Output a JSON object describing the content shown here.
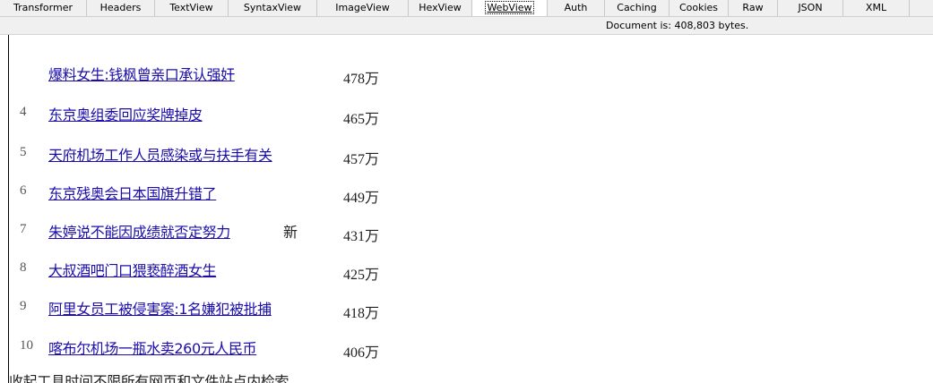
{
  "tabs": [
    {
      "label": "Transformer"
    },
    {
      "label": "Headers"
    },
    {
      "label": "TextView"
    },
    {
      "label": "SyntaxView"
    },
    {
      "label": "ImageView"
    },
    {
      "label": "HexView"
    },
    {
      "label": "WebView"
    },
    {
      "label": "Auth"
    },
    {
      "label": "Caching"
    },
    {
      "label": "Cookies"
    },
    {
      "label": "Raw"
    },
    {
      "label": "JSON"
    },
    {
      "label": "XML"
    }
  ],
  "active_tab": "WebView",
  "status": {
    "text": "Document is: 408,803 bytes."
  },
  "list": {
    "items": [
      {
        "rank": "",
        "title": "爆料女生:钱枫曾亲口承认强奸",
        "badge": "",
        "count": "478万"
      },
      {
        "rank": "4",
        "title": "东京奥组委回应奖牌掉皮",
        "badge": "",
        "count": "465万"
      },
      {
        "rank": "5",
        "title": "天府机场工作人员感染或与扶手有关",
        "badge": "",
        "count": "457万"
      },
      {
        "rank": "6",
        "title": "东京残奥会日本国旗升错了",
        "badge": "",
        "count": "449万"
      },
      {
        "rank": "7",
        "title": "朱婷说不能因成绩就否定努力",
        "badge": "新",
        "count": "431万"
      },
      {
        "rank": "8",
        "title": "大叔酒吧门口猥亵醉酒女生",
        "badge": "",
        "count": "425万"
      },
      {
        "rank": "9",
        "title": "阿里女员工被侵害案:1名嫌犯被批捕",
        "badge": "",
        "count": "418万"
      },
      {
        "rank": "10",
        "title": "喀布尔机场一瓶水卖260元人民币",
        "badge": "",
        "count": "406万"
      }
    ]
  },
  "footer": {
    "text": "收起工具时间不限所有网页和文件站点内检索"
  },
  "colors": {
    "link": "#1a0dab",
    "text": "#222222",
    "rank": "#555555",
    "toolbar_bg": "#f0f0f0"
  }
}
